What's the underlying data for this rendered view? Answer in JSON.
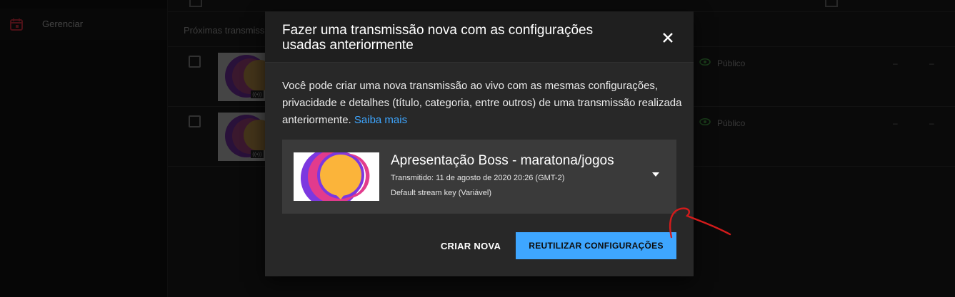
{
  "sidebar": {
    "manage_label": "Gerenciar"
  },
  "list": {
    "section_header": "Próximas transmissões",
    "rows": [
      {
        "visibility": "Público",
        "col_a": "–",
        "col_b": "–"
      },
      {
        "visibility": "Público",
        "col_a": "–",
        "col_b": "–"
      }
    ],
    "live_badge": "((•))"
  },
  "dialog": {
    "title": "Fazer uma transmissão nova com as configurações usadas anteriormente",
    "description": "Você pode criar uma nova transmissão ao vivo com as mesmas configurações, privacidade e detalhes (título, categoria, entre outros) de uma transmissão realizada anteriormente.",
    "learn_more": "Saiba mais",
    "stream": {
      "title": "Apresentação Boss - maratona/jogos",
      "date": "Transmitido: 11 de agosto de 2020 20:26 (GMT-2)",
      "key": "Default stream key (Variável)"
    },
    "create_new_label": "CRIAR NOVA",
    "reuse_label": "REUTILIZAR CONFIGURAÇÕES"
  },
  "colors": {
    "accent": "#3ea6ff",
    "dialog_bg": "#282828",
    "annotation": "#d21b1b"
  },
  "icons": [
    "calendar-icon",
    "close-icon",
    "chevron-down-icon",
    "eye-icon",
    "live-icon"
  ]
}
